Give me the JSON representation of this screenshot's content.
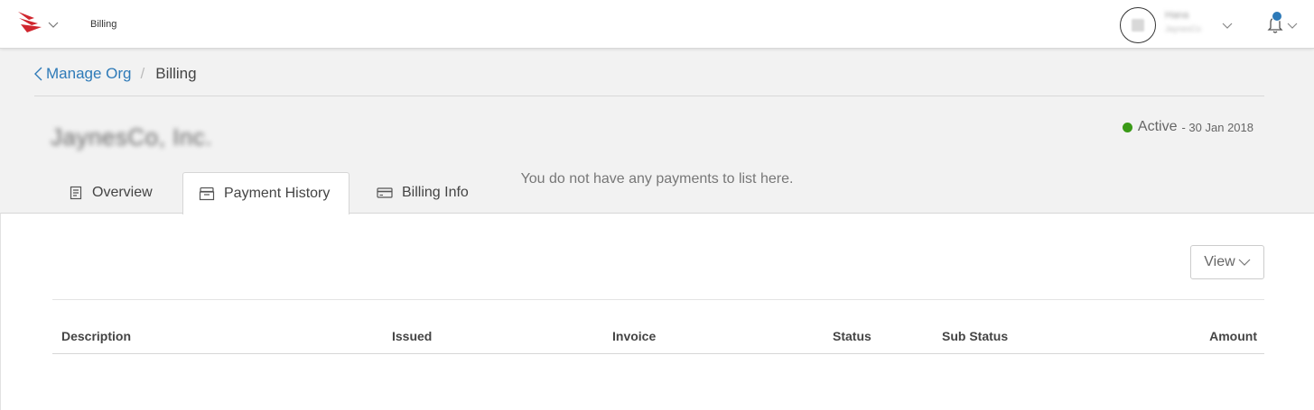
{
  "topbar": {
    "nav_title": "Billing",
    "user_name": "Hana",
    "user_org": "JaynesCo"
  },
  "breadcrumb": {
    "back_label": "Manage Org",
    "separator": "/",
    "current": "Billing"
  },
  "org": {
    "name": "JaynesCo, Inc.",
    "status_label": "Active",
    "status_date": "- 30 Jan 2018",
    "status_color": "#3a9a17"
  },
  "tabs": [
    {
      "label": "Overview",
      "icon": "document-icon",
      "active": false
    },
    {
      "label": "Payment History",
      "icon": "archive-icon",
      "active": true
    },
    {
      "label": "Billing Info",
      "icon": "credit-card-icon",
      "active": false
    }
  ],
  "toolbar": {
    "view_label": "View"
  },
  "table": {
    "columns": [
      "Description",
      "Issued",
      "Invoice",
      "Status",
      "Sub Status",
      "Amount"
    ],
    "rows": [],
    "empty_message": "You do not have any payments to list here."
  },
  "colors": {
    "accent": "#2e7ab8",
    "brand": "#d0262e",
    "notification_dot": "#2e7ab8"
  }
}
